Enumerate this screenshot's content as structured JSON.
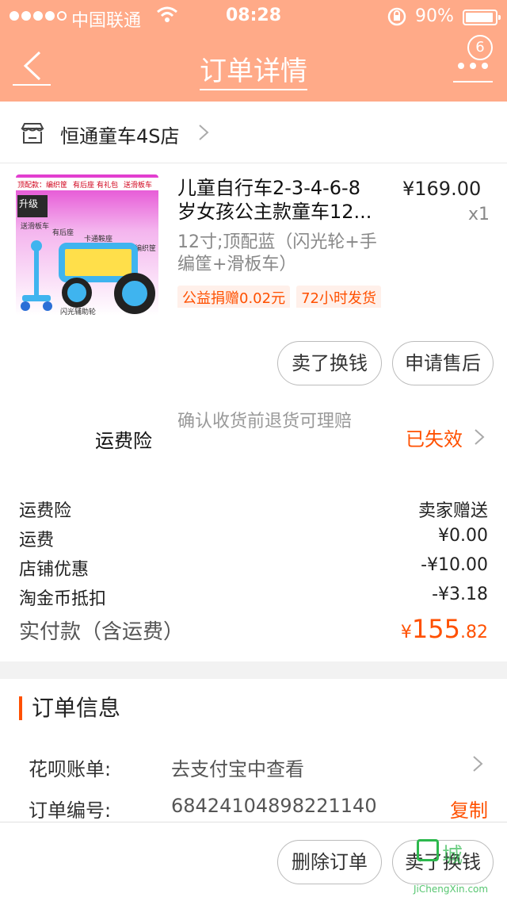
{
  "status_bar": {
    "carrier": "中国联通",
    "time": "08:28",
    "battery": "90%"
  },
  "nav": {
    "title": "订单详情",
    "badge": "6"
  },
  "shop": {
    "name": "恒通童车4S店"
  },
  "product": {
    "title_line1": "儿童自行车2-3-4-6-8",
    "title_line2": "岁女孩公主款童车12...",
    "price": "¥169.00",
    "quantity": "x1",
    "spec_line1": "12寸;顶配蓝（闪光轮+手",
    "spec_line2": "编筐+滑板车）",
    "tags": [
      "公益捐赠0.02元",
      "72小时发货"
    ],
    "image_text": {
      "top_tags": [
        "顶配款：编织筐",
        "有后座",
        "有礼包",
        "送滑板车"
      ],
      "upgrade": "升级",
      "labels": [
        "送滑板车",
        "有后座",
        "卡通鞍座",
        "编织筐",
        "闪光辅助轮"
      ]
    }
  },
  "actions": {
    "sell_label": "卖了换钱",
    "after_sale_label": "申请售后"
  },
  "insurance": {
    "label": "运费险",
    "desc": "确认收货前退货可理赔",
    "status": "已失效"
  },
  "fees": [
    {
      "key": "运费险",
      "value": "卖家赠送"
    },
    {
      "key": "运费",
      "value": "¥0.00"
    },
    {
      "key": "店铺优惠",
      "value": "-¥10.00"
    },
    {
      "key": "淘金币抵扣",
      "value": "-¥3.18"
    }
  ],
  "total": {
    "label": "实付款（含运费）",
    "currency": "¥",
    "integer": "155",
    "decimal": ".82"
  },
  "order_info": {
    "heading": "订单信息",
    "huabei_label": "花呗账单:",
    "huabei_value": "去支付宝中查看",
    "order_no_label": "订单编号:",
    "order_no_value": "68424104898221140",
    "copy_label": "复制"
  },
  "bottom": {
    "delete_label": "删除订单",
    "sell_label": "卖了换钱"
  },
  "watermark": {
    "text": "城",
    "url": "JiChengXin.com"
  },
  "colors": {
    "header": "#ffaa88",
    "accent": "#ff5000"
  }
}
